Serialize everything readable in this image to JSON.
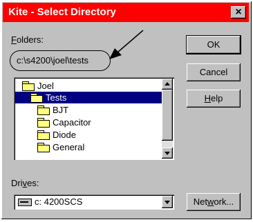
{
  "window": {
    "title": "Kite - Select Directory",
    "close_glyph": "×",
    "title_bar_color": "#ff0000"
  },
  "folders": {
    "label": "Folders:",
    "current_path": "c:\\s4200\\joel\\tests",
    "items": [
      {
        "label": "Joel",
        "icon": "open-folder-icon",
        "selected": false
      },
      {
        "label": "Tests",
        "icon": "open-folder-icon",
        "selected": true
      },
      {
        "label": "BJT",
        "icon": "folder-icon",
        "selected": false
      },
      {
        "label": "Capacitor",
        "icon": "folder-icon",
        "selected": false
      },
      {
        "label": "Diode",
        "icon": "folder-icon",
        "selected": false
      },
      {
        "label": "General",
        "icon": "folder-icon",
        "selected": false
      }
    ]
  },
  "drives": {
    "label": "Drives:",
    "selected": "c: 4200SCS",
    "icon": "drive-icon"
  },
  "buttons": {
    "ok": "OK",
    "cancel": "Cancel",
    "help": "Help",
    "network": "Network..."
  }
}
